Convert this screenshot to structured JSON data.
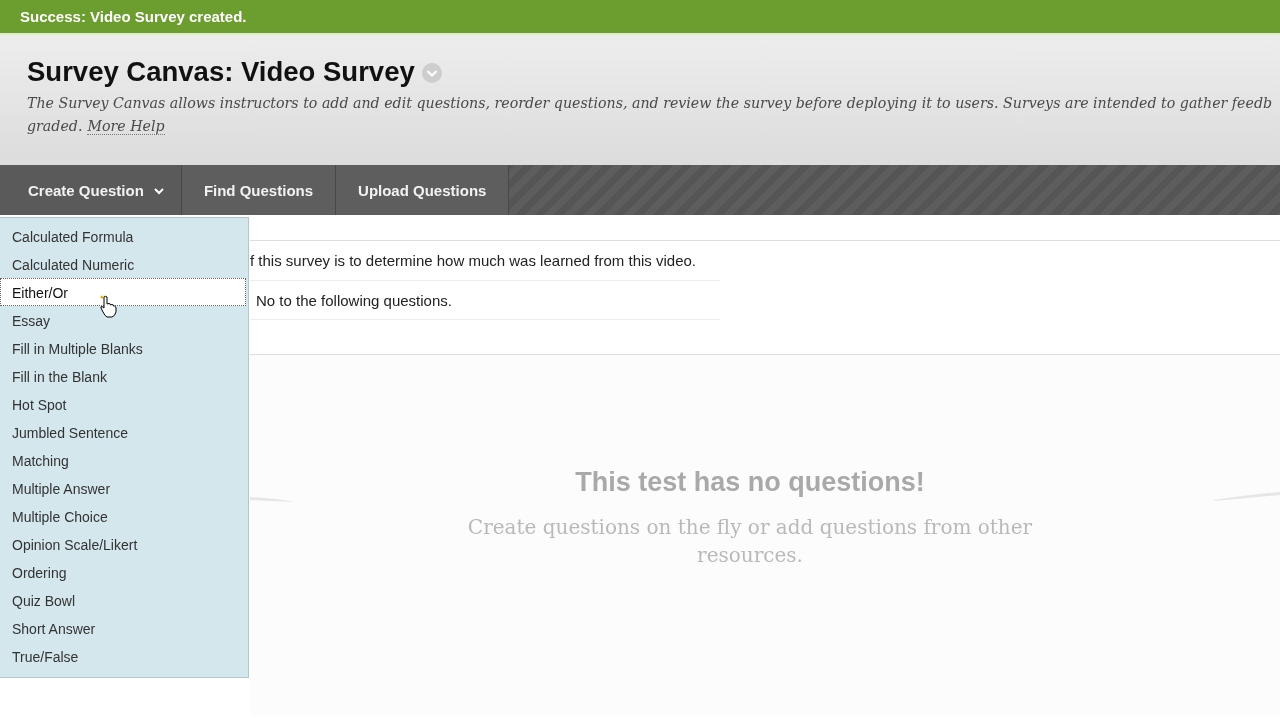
{
  "alert": {
    "message": "Success: Video Survey created."
  },
  "header": {
    "title": "Survey Canvas: Video Survey",
    "description_lines": [
      "The Survey Canvas allows instructors to add and edit questions, reorder questions, and review the survey before deploying it to users. Surveys are intended to gather feedb",
      "graded."
    ],
    "help_link": "More Help"
  },
  "nav": {
    "tabs": [
      {
        "label": "Create Question",
        "kind": "dropdown",
        "expanded": true,
        "menu": {
          "items": [
            {
              "label": "Calculated Formula",
              "selected": false
            },
            {
              "label": "Calculated Numeric",
              "selected": false
            },
            {
              "label": "Either/Or",
              "selected": true
            },
            {
              "label": "Essay",
              "selected": false
            },
            {
              "label": "Fill in Multiple Blanks",
              "selected": false
            },
            {
              "label": "Fill in the Blank",
              "selected": false
            },
            {
              "label": "Hot Spot",
              "selected": false
            },
            {
              "label": "Jumbled Sentence",
              "selected": false
            },
            {
              "label": "Matching",
              "selected": false
            },
            {
              "label": "Multiple Answer",
              "selected": false
            },
            {
              "label": "Multiple Choice",
              "selected": false
            },
            {
              "label": "Opinion Scale/Likert",
              "selected": false
            },
            {
              "label": "Ordering",
              "selected": false
            },
            {
              "label": "Quiz Bowl",
              "selected": false
            },
            {
              "label": "Short Answer",
              "selected": false
            },
            {
              "label": "True/False",
              "selected": false
            }
          ]
        }
      },
      {
        "label": "Find Questions",
        "kind": "button"
      },
      {
        "label": "Upload Questions",
        "kind": "button"
      }
    ]
  },
  "survey_info": {
    "lines": [
      "f this survey is to determine how much was learned from this video.",
      "No to the following questions."
    ]
  },
  "empty_state": {
    "title": "This test has no questions!",
    "message": "Create questions on the fly or add questions from other resources."
  }
}
